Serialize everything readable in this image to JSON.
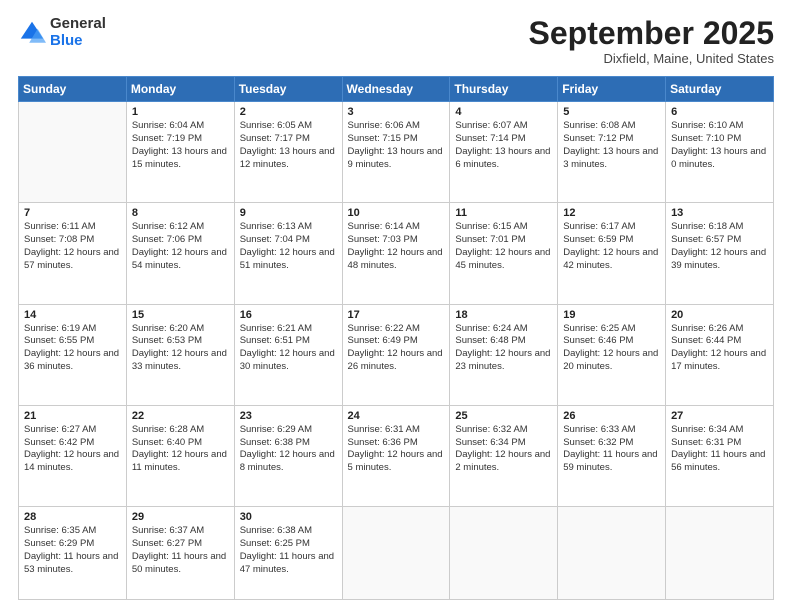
{
  "logo": {
    "general": "General",
    "blue": "Blue"
  },
  "title": {
    "month": "September 2025",
    "location": "Dixfield, Maine, United States"
  },
  "days_header": [
    "Sunday",
    "Monday",
    "Tuesday",
    "Wednesday",
    "Thursday",
    "Friday",
    "Saturday"
  ],
  "weeks": [
    [
      {
        "num": "",
        "sunrise": "",
        "sunset": "",
        "daylight": ""
      },
      {
        "num": "1",
        "sunrise": "Sunrise: 6:04 AM",
        "sunset": "Sunset: 7:19 PM",
        "daylight": "Daylight: 13 hours and 15 minutes."
      },
      {
        "num": "2",
        "sunrise": "Sunrise: 6:05 AM",
        "sunset": "Sunset: 7:17 PM",
        "daylight": "Daylight: 13 hours and 12 minutes."
      },
      {
        "num": "3",
        "sunrise": "Sunrise: 6:06 AM",
        "sunset": "Sunset: 7:15 PM",
        "daylight": "Daylight: 13 hours and 9 minutes."
      },
      {
        "num": "4",
        "sunrise": "Sunrise: 6:07 AM",
        "sunset": "Sunset: 7:14 PM",
        "daylight": "Daylight: 13 hours and 6 minutes."
      },
      {
        "num": "5",
        "sunrise": "Sunrise: 6:08 AM",
        "sunset": "Sunset: 7:12 PM",
        "daylight": "Daylight: 13 hours and 3 minutes."
      },
      {
        "num": "6",
        "sunrise": "Sunrise: 6:10 AM",
        "sunset": "Sunset: 7:10 PM",
        "daylight": "Daylight: 13 hours and 0 minutes."
      }
    ],
    [
      {
        "num": "7",
        "sunrise": "Sunrise: 6:11 AM",
        "sunset": "Sunset: 7:08 PM",
        "daylight": "Daylight: 12 hours and 57 minutes."
      },
      {
        "num": "8",
        "sunrise": "Sunrise: 6:12 AM",
        "sunset": "Sunset: 7:06 PM",
        "daylight": "Daylight: 12 hours and 54 minutes."
      },
      {
        "num": "9",
        "sunrise": "Sunrise: 6:13 AM",
        "sunset": "Sunset: 7:04 PM",
        "daylight": "Daylight: 12 hours and 51 minutes."
      },
      {
        "num": "10",
        "sunrise": "Sunrise: 6:14 AM",
        "sunset": "Sunset: 7:03 PM",
        "daylight": "Daylight: 12 hours and 48 minutes."
      },
      {
        "num": "11",
        "sunrise": "Sunrise: 6:15 AM",
        "sunset": "Sunset: 7:01 PM",
        "daylight": "Daylight: 12 hours and 45 minutes."
      },
      {
        "num": "12",
        "sunrise": "Sunrise: 6:17 AM",
        "sunset": "Sunset: 6:59 PM",
        "daylight": "Daylight: 12 hours and 42 minutes."
      },
      {
        "num": "13",
        "sunrise": "Sunrise: 6:18 AM",
        "sunset": "Sunset: 6:57 PM",
        "daylight": "Daylight: 12 hours and 39 minutes."
      }
    ],
    [
      {
        "num": "14",
        "sunrise": "Sunrise: 6:19 AM",
        "sunset": "Sunset: 6:55 PM",
        "daylight": "Daylight: 12 hours and 36 minutes."
      },
      {
        "num": "15",
        "sunrise": "Sunrise: 6:20 AM",
        "sunset": "Sunset: 6:53 PM",
        "daylight": "Daylight: 12 hours and 33 minutes."
      },
      {
        "num": "16",
        "sunrise": "Sunrise: 6:21 AM",
        "sunset": "Sunset: 6:51 PM",
        "daylight": "Daylight: 12 hours and 30 minutes."
      },
      {
        "num": "17",
        "sunrise": "Sunrise: 6:22 AM",
        "sunset": "Sunset: 6:49 PM",
        "daylight": "Daylight: 12 hours and 26 minutes."
      },
      {
        "num": "18",
        "sunrise": "Sunrise: 6:24 AM",
        "sunset": "Sunset: 6:48 PM",
        "daylight": "Daylight: 12 hours and 23 minutes."
      },
      {
        "num": "19",
        "sunrise": "Sunrise: 6:25 AM",
        "sunset": "Sunset: 6:46 PM",
        "daylight": "Daylight: 12 hours and 20 minutes."
      },
      {
        "num": "20",
        "sunrise": "Sunrise: 6:26 AM",
        "sunset": "Sunset: 6:44 PM",
        "daylight": "Daylight: 12 hours and 17 minutes."
      }
    ],
    [
      {
        "num": "21",
        "sunrise": "Sunrise: 6:27 AM",
        "sunset": "Sunset: 6:42 PM",
        "daylight": "Daylight: 12 hours and 14 minutes."
      },
      {
        "num": "22",
        "sunrise": "Sunrise: 6:28 AM",
        "sunset": "Sunset: 6:40 PM",
        "daylight": "Daylight: 12 hours and 11 minutes."
      },
      {
        "num": "23",
        "sunrise": "Sunrise: 6:29 AM",
        "sunset": "Sunset: 6:38 PM",
        "daylight": "Daylight: 12 hours and 8 minutes."
      },
      {
        "num": "24",
        "sunrise": "Sunrise: 6:31 AM",
        "sunset": "Sunset: 6:36 PM",
        "daylight": "Daylight: 12 hours and 5 minutes."
      },
      {
        "num": "25",
        "sunrise": "Sunrise: 6:32 AM",
        "sunset": "Sunset: 6:34 PM",
        "daylight": "Daylight: 12 hours and 2 minutes."
      },
      {
        "num": "26",
        "sunrise": "Sunrise: 6:33 AM",
        "sunset": "Sunset: 6:32 PM",
        "daylight": "Daylight: 11 hours and 59 minutes."
      },
      {
        "num": "27",
        "sunrise": "Sunrise: 6:34 AM",
        "sunset": "Sunset: 6:31 PM",
        "daylight": "Daylight: 11 hours and 56 minutes."
      }
    ],
    [
      {
        "num": "28",
        "sunrise": "Sunrise: 6:35 AM",
        "sunset": "Sunset: 6:29 PM",
        "daylight": "Daylight: 11 hours and 53 minutes."
      },
      {
        "num": "29",
        "sunrise": "Sunrise: 6:37 AM",
        "sunset": "Sunset: 6:27 PM",
        "daylight": "Daylight: 11 hours and 50 minutes."
      },
      {
        "num": "30",
        "sunrise": "Sunrise: 6:38 AM",
        "sunset": "Sunset: 6:25 PM",
        "daylight": "Daylight: 11 hours and 47 minutes."
      },
      {
        "num": "",
        "sunrise": "",
        "sunset": "",
        "daylight": ""
      },
      {
        "num": "",
        "sunrise": "",
        "sunset": "",
        "daylight": ""
      },
      {
        "num": "",
        "sunrise": "",
        "sunset": "",
        "daylight": ""
      },
      {
        "num": "",
        "sunrise": "",
        "sunset": "",
        "daylight": ""
      }
    ]
  ]
}
